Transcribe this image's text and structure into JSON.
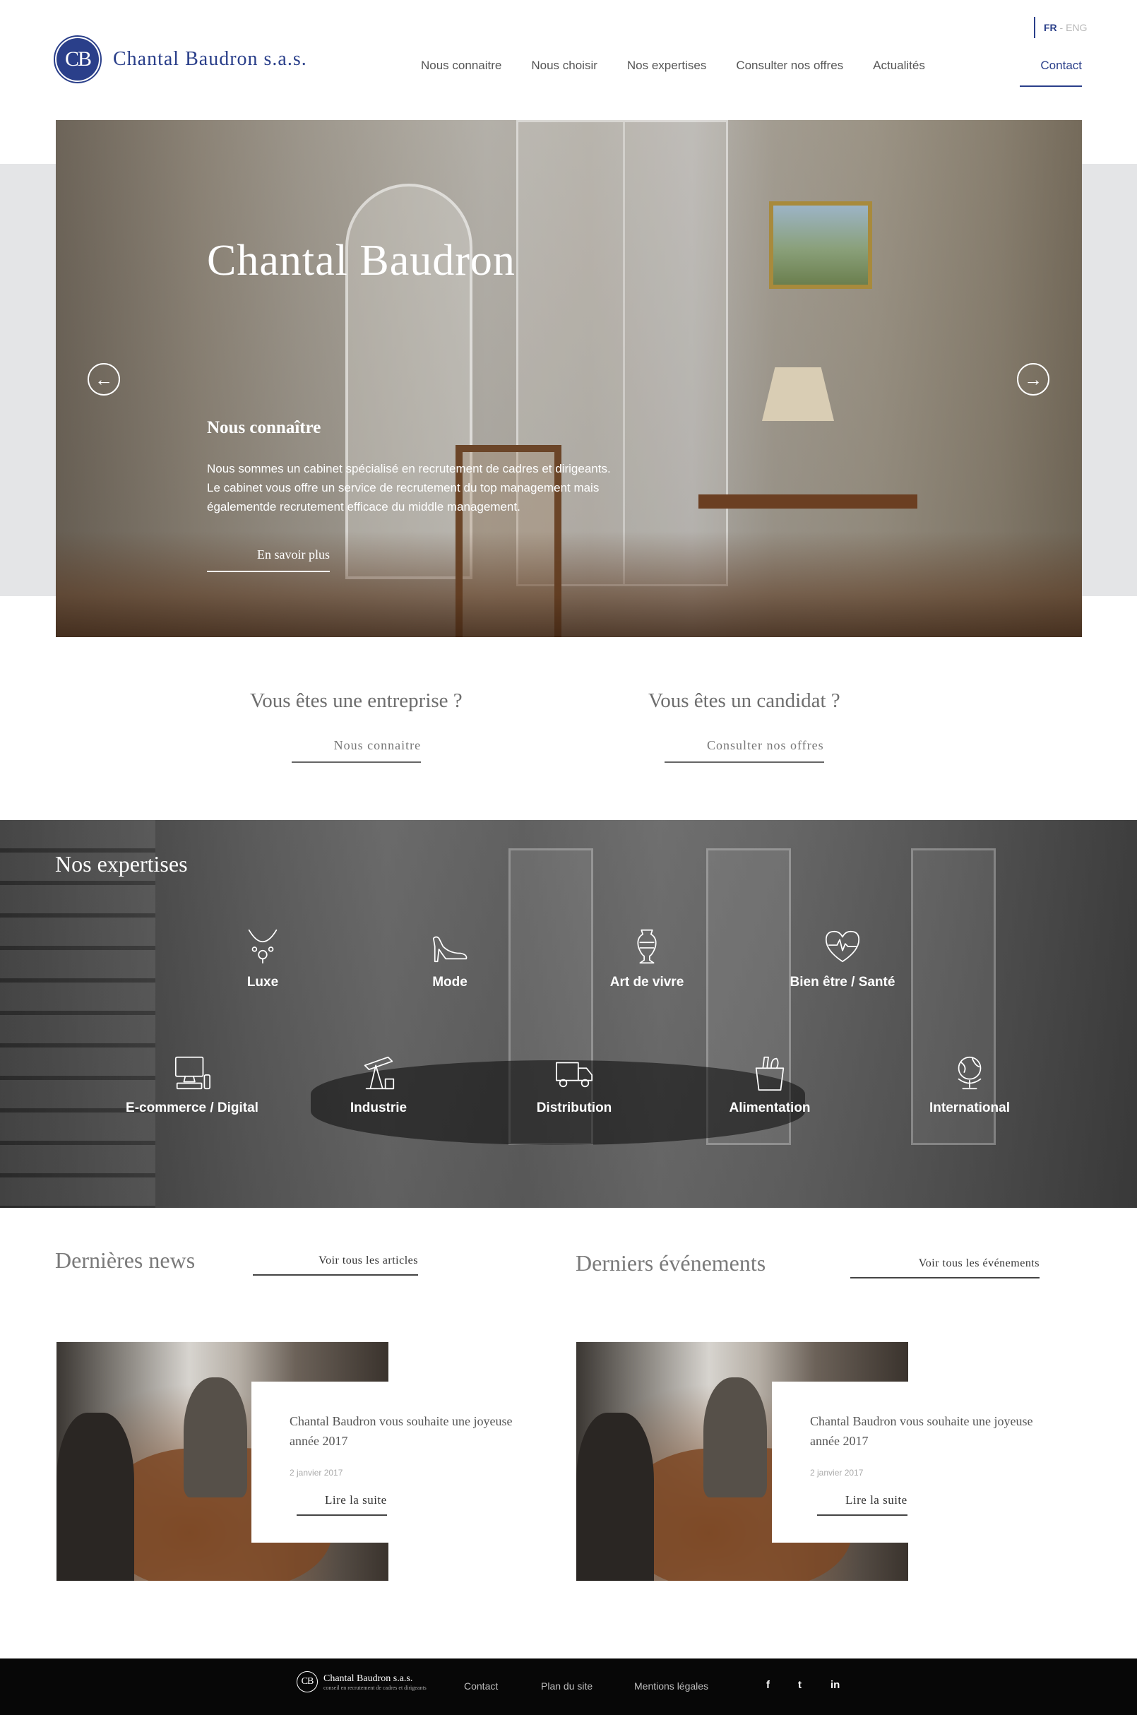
{
  "header": {
    "lang_active": "FR",
    "lang_sep": " - ",
    "lang_other": "ENG",
    "logo_mark": "CB",
    "logo_text": "Chantal Baudron s.a.s.",
    "nav": [
      "Nous connaitre",
      "Nous choisir",
      "Nos expertises",
      "Consulter nos offres",
      "Actualités"
    ],
    "contact": "Contact"
  },
  "hero": {
    "title": "Chantal Baudron",
    "subtitle": "Nous connaître",
    "text": [
      "Nous sommes un cabinet spécialisé en recrutement de cadres et dirigeants.",
      "Le cabinet vous offre un service de recrutement du top management mais",
      "égalementde recrutement efficace du middle management."
    ],
    "button": "En savoir plus",
    "prev_icon": "arrow-left-icon",
    "next_icon": "arrow-right-icon"
  },
  "cta": {
    "company": {
      "title": "Vous êtes une entreprise ?",
      "link": "Nous connaitre"
    },
    "candidate": {
      "title": "Vous êtes un candidat ?",
      "link": "Consulter nos offres"
    }
  },
  "expertises": {
    "title": "Nos expertises",
    "items": [
      {
        "label": "Luxe",
        "icon": "necklace-icon"
      },
      {
        "label": "Mode",
        "icon": "high-heel-icon"
      },
      {
        "label": "Art de vivre",
        "icon": "vase-icon"
      },
      {
        "label": "Bien être / Santé",
        "icon": "heart-pulse-icon"
      },
      {
        "label": "E-commerce / Digital",
        "icon": "computer-icon"
      },
      {
        "label": "Industrie",
        "icon": "oil-pump-icon"
      },
      {
        "label": "Distribution",
        "icon": "truck-icon"
      },
      {
        "label": "Alimentation",
        "icon": "grocery-bag-icon"
      },
      {
        "label": "International",
        "icon": "globe-icon"
      }
    ]
  },
  "news": {
    "title": "Dernières news",
    "link": "Voir tous les articles",
    "card": {
      "title": "Chantal Baudron vous souhaite une joyeuse année 2017",
      "date": "2 janvier 2017",
      "more": "Lire la suite"
    }
  },
  "events": {
    "title": "Derniers événements",
    "link": "Voir tous les événements",
    "card": {
      "title": "Chantal Baudron vous souhaite une joyeuse année 2017",
      "date": "2 janvier 2017",
      "more": "Lire la suite"
    }
  },
  "footer": {
    "logo_mark": "CB",
    "logo_name": "Chantal Baudron s.a.s.",
    "logo_tagline": "conseil en recrutement de cadres et dirigeants",
    "links": [
      "Contact",
      "Plan du site",
      "Mentions légales"
    ],
    "social": [
      "f",
      "t",
      "in"
    ]
  }
}
